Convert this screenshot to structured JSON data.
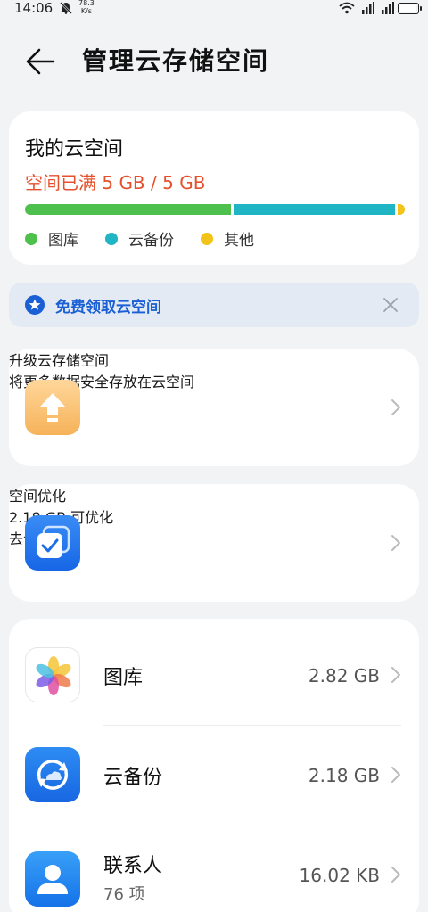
{
  "status_bar": {
    "time": "14:06",
    "speed_value": "78.3",
    "speed_unit": "K/s"
  },
  "header": {
    "title": "管理云存储空间"
  },
  "storage": {
    "name": "我的云空间",
    "usage": "空间已满 5 GB / 5 GB",
    "segments": [
      {
        "label": "图库",
        "fraction": 0.55,
        "color": "#4ec04e"
      },
      {
        "label": "云备份",
        "fraction": 0.43,
        "color": "#1fb5c4"
      },
      {
        "label": "其他",
        "fraction": 0.02,
        "color": "#f2c318"
      }
    ],
    "legend": [
      "图库",
      "云备份",
      "其他"
    ]
  },
  "promo": {
    "text": "免费领取云空间"
  },
  "upgrade": {
    "title": "升级云存储空间",
    "subtitle": "将更多数据安全存放在云空间"
  },
  "optimize": {
    "title": "空间优化",
    "subtitle": "2.18 GB 可优化",
    "action": "去优化"
  },
  "apps": [
    {
      "name": "图库",
      "size": "2.82 GB",
      "sub": ""
    },
    {
      "name": "云备份",
      "size": "2.18 GB",
      "sub": ""
    },
    {
      "name": "联系人",
      "size": "16.02 KB",
      "sub": "76 项"
    }
  ],
  "colors": {
    "accent_blue": "#1a5fd4",
    "warning_orange": "#e5512d",
    "background": "#f1f3f5"
  }
}
